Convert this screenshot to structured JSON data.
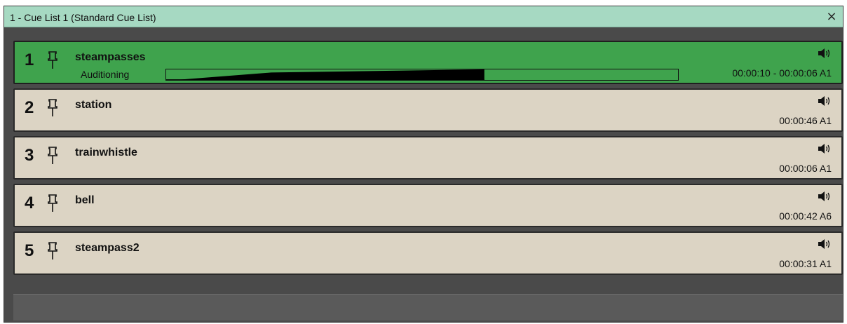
{
  "window": {
    "title": "1 - Cue List 1 (Standard Cue List)",
    "close_label": "×"
  },
  "colors": {
    "titlebar": "#a6d9c2",
    "active_cue": "#3fa34d",
    "idle_cue": "#dcd4c4",
    "background": "#4a4a4a"
  },
  "cues": [
    {
      "number": "1",
      "name": "steampasses",
      "status": "Auditioning",
      "time": "00:00:10 - 00:00:06",
      "output": "A1",
      "active": true,
      "progress_fraction": 0.62
    },
    {
      "number": "2",
      "name": "station",
      "time": "00:00:46",
      "output": "A1",
      "active": false
    },
    {
      "number": "3",
      "name": "trainwhistle",
      "time": "00:00:06",
      "output": "A1",
      "active": false
    },
    {
      "number": "4",
      "name": "bell",
      "time": "00:00:42",
      "output": "A6",
      "active": false
    },
    {
      "number": "5",
      "name": "steampass2",
      "time": "00:00:31",
      "output": "A1",
      "active": false
    }
  ],
  "icons": {
    "pin": "pin-icon",
    "speaker": "speaker-icon",
    "close": "close-icon"
  }
}
